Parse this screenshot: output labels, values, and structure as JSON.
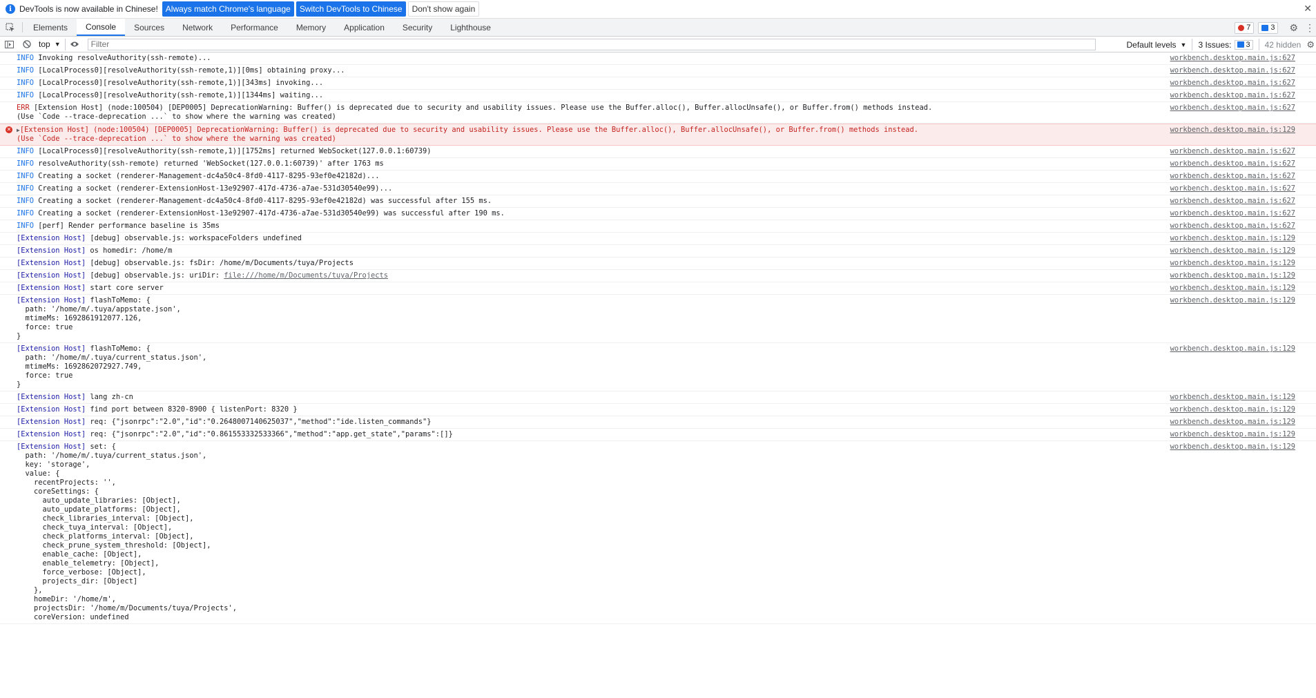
{
  "infobar": {
    "message": "DevTools is now available in Chinese!",
    "btn_match": "Always match Chrome's language",
    "btn_switch": "Switch DevTools to Chinese",
    "btn_dismiss": "Don't show again",
    "close_glyph": "✕"
  },
  "tabs": [
    "Elements",
    "Console",
    "Sources",
    "Network",
    "Performance",
    "Memory",
    "Application",
    "Security",
    "Lighthouse"
  ],
  "active_tab": "Console",
  "tab_right": {
    "errors": "7",
    "messages": "3"
  },
  "toolbar": {
    "context": "top",
    "filter_placeholder": "Filter",
    "levels": "Default levels",
    "issues_label": "3 Issues:",
    "issues_count": "3",
    "hidden": "42 hidden"
  },
  "colors": {
    "accent": "#1a73e8",
    "error_bg": "#fcebeb",
    "error_text": "#c5221f",
    "host": "#1a1aa6"
  },
  "messages": [
    {
      "type": "info",
      "level": "INFO",
      "text": "Invoking resolveAuthority(ssh-remote)...",
      "source": "workbench.desktop.main.js:627"
    },
    {
      "type": "info",
      "level": "INFO",
      "text": "[LocalProcess0][resolveAuthority(ssh-remote,1)][0ms] obtaining proxy...",
      "source": "workbench.desktop.main.js:627"
    },
    {
      "type": "info",
      "level": "INFO",
      "text": "[LocalProcess0][resolveAuthority(ssh-remote,1)][343ms] invoking...",
      "source": "workbench.desktop.main.js:627"
    },
    {
      "type": "info",
      "level": "INFO",
      "text": "[LocalProcess0][resolveAuthority(ssh-remote,1)][1344ms] waiting...",
      "source": "workbench.desktop.main.js:627"
    },
    {
      "type": "err",
      "level": "ERR",
      "text": "[Extension Host] (node:100504) [DEP0005] DeprecationWarning: Buffer() is deprecated due to security and usability issues. Please use the Buffer.alloc(), Buffer.allocUnsafe(), or Buffer.from() methods instead.",
      "text2": "(Use `Code --trace-deprecation ...` to show where the warning was created)",
      "source": "workbench.desktop.main.js:627"
    },
    {
      "type": "error",
      "host": "[Extension Host]",
      "text": " (node:100504) [DEP0005] DeprecationWarning: Buffer() is deprecated due to security and usability issues. Please use the Buffer.alloc(), Buffer.allocUnsafe(), or Buffer.from() methods instead.",
      "text2": "(Use `Code --trace-deprecation ...` to show where the warning was created)",
      "source": "workbench.desktop.main.js:129"
    },
    {
      "type": "info",
      "level": "INFO",
      "text": "[LocalProcess0][resolveAuthority(ssh-remote,1)][1752ms] returned WebSocket(127.0.0.1:60739)",
      "source": "workbench.desktop.main.js:627"
    },
    {
      "type": "info",
      "level": "INFO",
      "text": "resolveAuthority(ssh-remote) returned 'WebSocket(127.0.0.1:60739)' after 1763 ms",
      "source": "workbench.desktop.main.js:627"
    },
    {
      "type": "info",
      "level": "INFO",
      "text": "Creating a socket (renderer-Management-dc4a50c4-8fd0-4117-8295-93ef0e42182d)...",
      "source": "workbench.desktop.main.js:627"
    },
    {
      "type": "info",
      "level": "INFO",
      "text": "Creating a socket (renderer-ExtensionHost-13e92907-417d-4736-a7ae-531d30540e99)...",
      "source": "workbench.desktop.main.js:627"
    },
    {
      "type": "info",
      "level": "INFO",
      "text": "Creating a socket (renderer-Management-dc4a50c4-8fd0-4117-8295-93ef0e42182d) was successful after 155 ms.",
      "source": "workbench.desktop.main.js:627"
    },
    {
      "type": "info",
      "level": "INFO",
      "text": "Creating a socket (renderer-ExtensionHost-13e92907-417d-4736-a7ae-531d30540e99) was successful after 190 ms.",
      "source": "workbench.desktop.main.js:627"
    },
    {
      "type": "info",
      "level": "INFO",
      "text": "[perf] Render performance baseline is 35ms",
      "source": "workbench.desktop.main.js:627"
    },
    {
      "type": "host",
      "host": "[Extension Host]",
      "text": " [debug] observable.js: workspaceFolders undefined",
      "source": "workbench.desktop.main.js:129"
    },
    {
      "type": "host",
      "host": "[Extension Host]",
      "text": " os homedir: /home/m",
      "source": "workbench.desktop.main.js:129"
    },
    {
      "type": "host",
      "host": "[Extension Host]",
      "text": " [debug] observable.js: fsDir: /home/m/Documents/tuya/Projects",
      "source": "workbench.desktop.main.js:129"
    },
    {
      "type": "host",
      "host": "[Extension Host]",
      "text": " [debug] observable.js: uriDir: ",
      "link": "file:///home/m/Documents/tuya/Projects",
      "source": "workbench.desktop.main.js:129"
    },
    {
      "type": "host",
      "host": "[Extension Host]",
      "text": " start core server",
      "source": "workbench.desktop.main.js:129"
    },
    {
      "type": "host",
      "host": "[Extension Host]",
      "text": " flashToMemo: {\n  path: '/home/m/.tuya/appstate.json',\n  mtimeMs: 1692861912077.126,\n  force: true\n}",
      "source": "workbench.desktop.main.js:129"
    },
    {
      "type": "host",
      "host": "[Extension Host]",
      "text": " flashToMemo: {\n  path: '/home/m/.tuya/current_status.json',\n  mtimeMs: 1692862072927.749,\n  force: true\n}",
      "source": "workbench.desktop.main.js:129"
    },
    {
      "type": "host",
      "host": "[Extension Host]",
      "text": " lang zh-cn",
      "source": "workbench.desktop.main.js:129"
    },
    {
      "type": "host",
      "host": "[Extension Host]",
      "text": " find port between 8320-8900 { listenPort: 8320 }",
      "source": "workbench.desktop.main.js:129"
    },
    {
      "type": "host",
      "host": "[Extension Host]",
      "text": " req: {\"jsonrpc\":\"2.0\",\"id\":\"0.2648007140625037\",\"method\":\"ide.listen_commands\"}",
      "source": "workbench.desktop.main.js:129"
    },
    {
      "type": "host",
      "host": "[Extension Host]",
      "text": " req: {\"jsonrpc\":\"2.0\",\"id\":\"0.861553332533366\",\"method\":\"app.get_state\",\"params\":[]}",
      "source": "workbench.desktop.main.js:129"
    },
    {
      "type": "host",
      "host": "[Extension Host]",
      "text": " set: {\n  path: '/home/m/.tuya/current_status.json',\n  key: 'storage',\n  value: {\n    recentProjects: '',\n    coreSettings: {\n      auto_update_libraries: [Object],\n      auto_update_platforms: [Object],\n      check_libraries_interval: [Object],\n      check_tuya_interval: [Object],\n      check_platforms_interval: [Object],\n      check_prune_system_threshold: [Object],\n      enable_cache: [Object],\n      enable_telemetry: [Object],\n      force_verbose: [Object],\n      projects_dir: [Object]\n    },\n    homeDir: '/home/m',\n    projectsDir: '/home/m/Documents/tuya/Projects',\n    coreVersion: undefined",
      "source": "workbench.desktop.main.js:129"
    }
  ]
}
